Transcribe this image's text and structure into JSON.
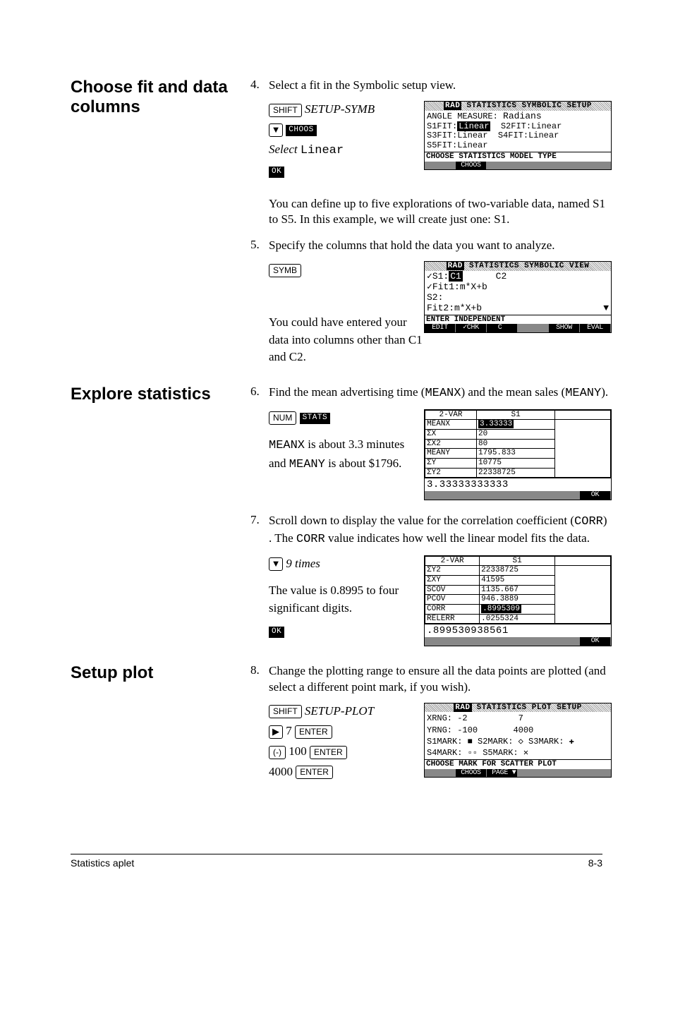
{
  "sections": {
    "fit": "Choose fit and data columns",
    "explore": "Explore statistics",
    "setup": "Setup plot"
  },
  "steps": {
    "s4": {
      "num": "4.",
      "text": "Select a fit in the Symbolic setup view.",
      "keys": {
        "shift": "SHIFT",
        "cmd": "SETUP-SYMB",
        "down": "▼",
        "choos": "CHOOS",
        "select": "Select",
        "linear": "Linear",
        "ok": "OK"
      },
      "para": "You can define up to five explorations of two-variable data, named S1 to S5. In this example, we will create just one: S1."
    },
    "s5": {
      "num": "5.",
      "text": "Specify the columns that hold the data you want to analyze.",
      "symb": "SYMB",
      "para": "You could have entered your data into columns other than C1 and C2."
    },
    "s6": {
      "num": "6.",
      "text1": "Find the mean advertising time (",
      "meanx": "MEANX",
      "text2": ") and the mean sales (",
      "meany": "MEANY",
      "text3": ").",
      "num_key": "NUM",
      "stats": "STATS",
      "para": "MEANX is about 3.3 minutes and MEANY is about $1796."
    },
    "s7": {
      "num": "7.",
      "text1": "Scroll down to display the value for the correlation coefficient (",
      "corr": "CORR",
      "text2": ") . The ",
      "corr2": "CORR",
      "text3": " value indicates how well the linear model fits the data.",
      "down": "▼",
      "times": "9 times",
      "para": "The value is 0.8995 to four significant digits.",
      "ok": "OK"
    },
    "s8": {
      "num": "8.",
      "text": "Change the plotting range to ensure all the data points are plotted (and select a different point mark, if you wish).",
      "keys": {
        "shift": "SHIFT",
        "cmd": "SETUP-PLOT",
        "right": "▶",
        "seven": "7",
        "enter": "ENTER",
        "neg": "(-)",
        "hundred": "100",
        "fourk": "4000"
      }
    }
  },
  "screens": {
    "symb_setup": {
      "title": "STATISTICS SYMBOLIC SETUP",
      "l1": "ANGLE MEASURE:",
      "l1v": "Radians",
      "s1fit": "S1FIT:",
      "s1v": "Linear",
      "s2fit": "S2FIT:",
      "s2v": "Linear",
      "s3fit": "S3FIT:",
      "s3v": "Linear",
      "s4fit": "S4FIT:",
      "s4v": "Linear",
      "s5fit": "S5FIT:",
      "s5v": "Linear",
      "help": "CHOOSE STATISTICS MODEL TYPE",
      "sk2": "CHOOS"
    },
    "symb_view": {
      "title": "STATISTICS SYMBOLIC VIEW",
      "l1a": "✓S1:",
      "l1b": "C1",
      "l1c": "C2",
      "l2": "✓Fit1:m*X+b",
      "l3": " S2:",
      "l4": " Fit2:m*X+b",
      "help": "ENTER INDEPENDENT",
      "sk": [
        "EDIT",
        "✓CHK",
        " C  ",
        "",
        "SHOW",
        "EVAL"
      ]
    },
    "stats1": {
      "hdr": [
        "2-VAR",
        "S1"
      ],
      "rows": [
        [
          "MEANX",
          "3.33333"
        ],
        [
          "ΣX",
          "20"
        ],
        [
          "ΣX2",
          "80"
        ],
        [
          "MEANY",
          "1795.833"
        ],
        [
          "ΣY",
          "10775"
        ],
        [
          "ΣY2",
          "22338725"
        ]
      ],
      "readout": "3.33333333333",
      "ok": "OK"
    },
    "stats2": {
      "hdr": [
        "2-VAR",
        "S1"
      ],
      "rows": [
        [
          "ΣY2",
          "22338725"
        ],
        [
          "ΣXY",
          "41595"
        ],
        [
          "SCOV",
          "1135.667"
        ],
        [
          "PCOV",
          "946.3889"
        ],
        [
          "CORR",
          ".8995309"
        ],
        [
          "RELERR",
          ".0255324"
        ]
      ],
      "readout": ".899530938561",
      "ok": "OK"
    },
    "plot_setup": {
      "title": "STATISTICS PLOT SETUP",
      "xrng": "XRNG:",
      "xr1": "-2",
      "xr2": "7",
      "yrng": "YRNG:",
      "yr1": "-100",
      "yr2": "4000",
      "marks": "S1MARK: ■  S2MARK: ◇  S3MARK: ✚",
      "marks2": "S4MARK: ▫▫ S5MARK: ✕",
      "help": "CHOOSE MARK FOR SCATTER PLOT",
      "sk": [
        "",
        "CHOOS",
        " PAGE ▼",
        "",
        "",
        ""
      ]
    }
  },
  "footer": {
    "left": "Statistics aplet",
    "right": "8-3"
  }
}
